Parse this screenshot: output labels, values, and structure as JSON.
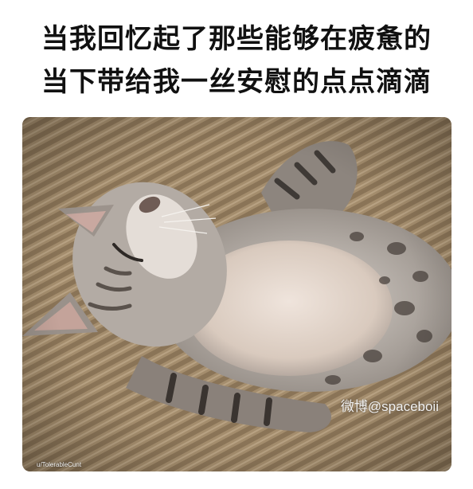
{
  "caption": {
    "line1": "当我回忆起了那些能够在疲惫的",
    "line2": "当下带给我一丝安慰的点点滴滴"
  },
  "photo": {
    "watermark": "微博@spaceboii",
    "credit": "u/TolerableCunt"
  }
}
